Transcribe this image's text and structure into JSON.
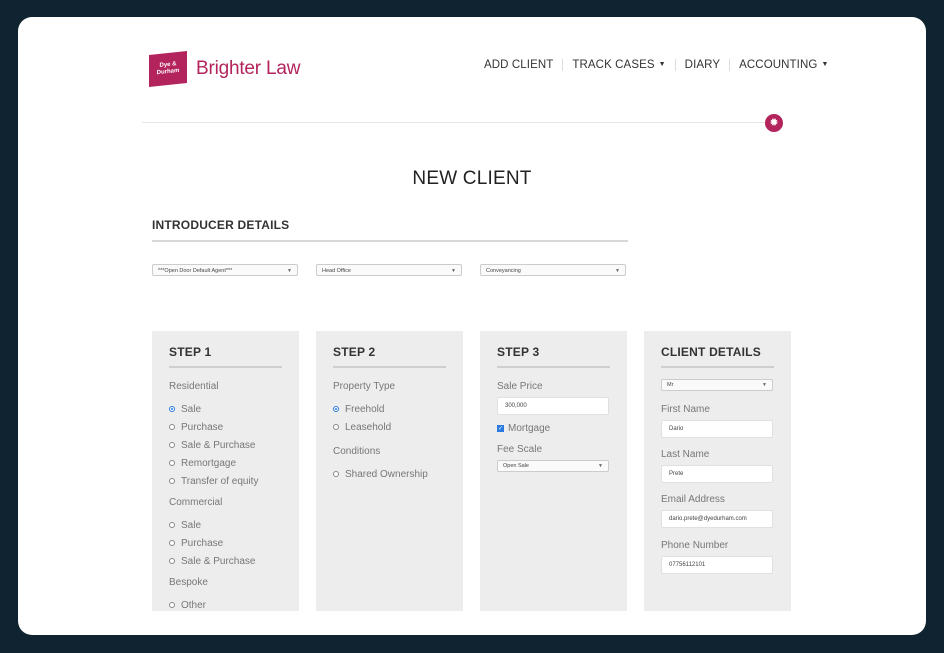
{
  "brand": {
    "mark_text": "Dye & Durham",
    "name": "Brighter Law",
    "color": "#b3245c"
  },
  "nav": [
    {
      "label": "ADD CLIENT",
      "dropdown": false
    },
    {
      "label": "TRACK CASES",
      "dropdown": true
    },
    {
      "label": "DIARY",
      "dropdown": false
    },
    {
      "label": "ACCOUNTING",
      "dropdown": true
    }
  ],
  "page_title": "NEW CLIENT",
  "introducer": {
    "title": "INTRODUCER DETAILS",
    "selects": [
      "***Open Door Default Agent***",
      "Head Office",
      "Conveyancing"
    ]
  },
  "step1": {
    "title": "STEP 1",
    "residential_label": "Residential",
    "residential": [
      {
        "label": "Sale",
        "selected": true
      },
      {
        "label": "Purchase",
        "selected": false
      },
      {
        "label": "Sale & Purchase",
        "selected": false
      },
      {
        "label": "Remortgage",
        "selected": false
      },
      {
        "label": "Transfer of equity",
        "selected": false
      }
    ],
    "commercial_label": "Commercial",
    "commercial": [
      {
        "label": "Sale",
        "selected": false
      },
      {
        "label": "Purchase",
        "selected": false
      },
      {
        "label": "Sale & Purchase",
        "selected": false
      }
    ],
    "bespoke_label": "Bespoke",
    "bespoke": [
      {
        "label": "Other",
        "selected": false
      }
    ]
  },
  "step2": {
    "title": "STEP 2",
    "property_type_label": "Property Type",
    "property_types": [
      {
        "label": "Freehold",
        "selected": true
      },
      {
        "label": "Leasehold",
        "selected": false
      }
    ],
    "conditions_label": "Conditions",
    "conditions": [
      {
        "label": "Shared Ownership",
        "selected": false
      }
    ]
  },
  "step3": {
    "title": "STEP 3",
    "sale_price_label": "Sale Price",
    "sale_price": "300,000",
    "mortgage_label": "Mortgage",
    "mortgage_checked": true,
    "fee_scale_label": "Fee Scale",
    "fee_scale": "Open Sale"
  },
  "client": {
    "title": "CLIENT DETAILS",
    "title_select": "Mr",
    "first_name_label": "First Name",
    "first_name": "Dario",
    "last_name_label": "Last Name",
    "last_name": "Prete",
    "email_label": "Email Address",
    "email": "dario.prete@dyedurham.com",
    "phone_label": "Phone Number",
    "phone": "07756112101"
  }
}
